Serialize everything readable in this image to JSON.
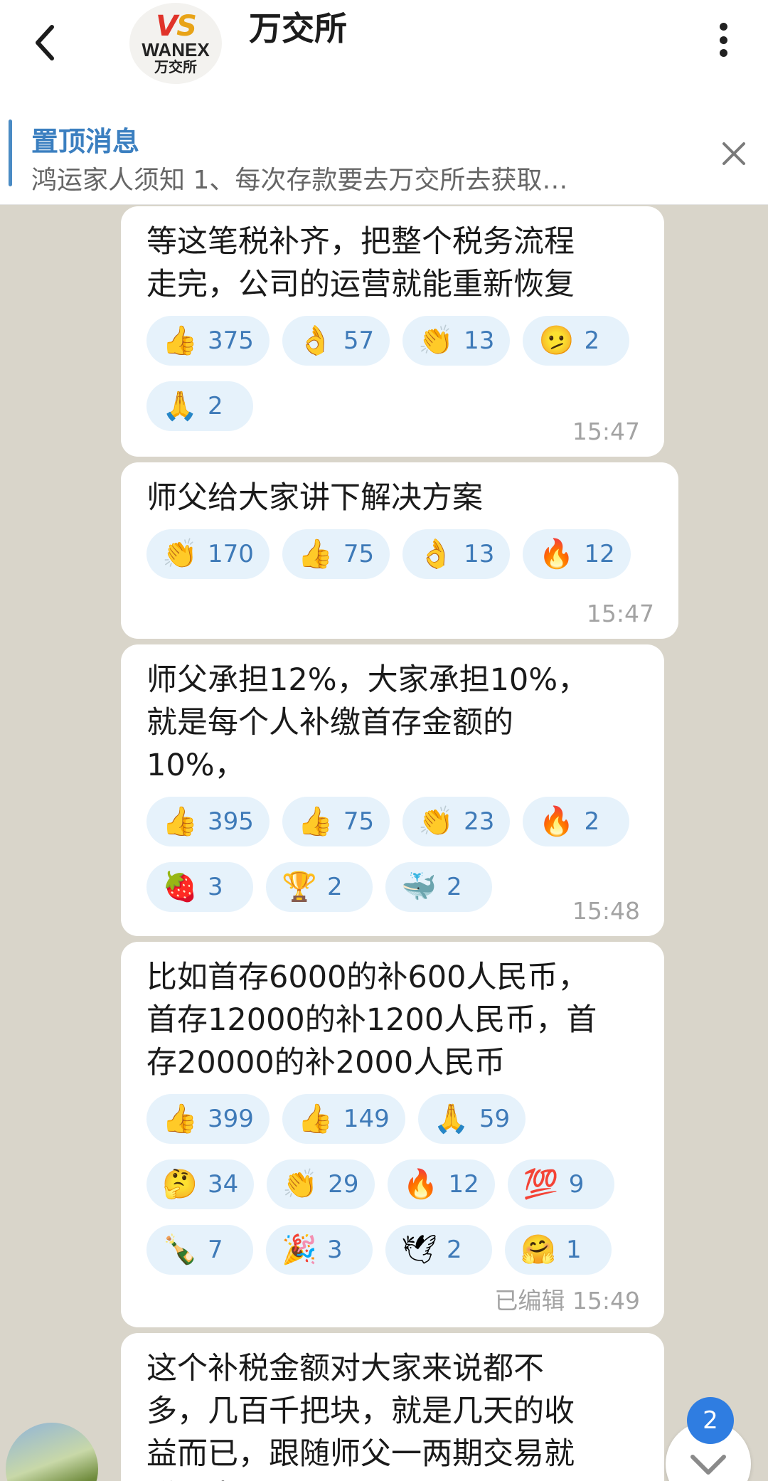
{
  "header": {
    "title": "万交所",
    "logo_mark": "VS",
    "logo_en": "WANEX",
    "logo_cn": "万交所"
  },
  "pinned": {
    "title": "置顶消息",
    "text": "鸿运家人须知  1、每次存款要去万交所去获取…"
  },
  "messages": [
    {
      "text": "等这笔税补齐，把整个税务流程\n走完，公司的运营就能重新恢复",
      "time": "15:47",
      "reactions": [
        {
          "emoji": "👍",
          "icon": "thumbs-up-icon",
          "count": "375"
        },
        {
          "emoji": "👌",
          "icon": "ok-hand-icon",
          "count": "57"
        },
        {
          "emoji": "👏",
          "icon": "clapping-hands-icon",
          "count": "13"
        },
        {
          "emoji": "🫤",
          "icon": "slightly-confused-face-icon",
          "count": "2"
        },
        {
          "emoji": "🙏",
          "icon": "folded-hands-icon",
          "count": "2"
        }
      ]
    },
    {
      "text": "师父给大家讲下解决方案",
      "time": "15:47",
      "reactions": [
        {
          "emoji": "👏",
          "icon": "clapping-hands-icon",
          "count": "170"
        },
        {
          "emoji": "👍",
          "icon": "thumbs-up-icon",
          "count": "75"
        },
        {
          "emoji": "👌",
          "icon": "ok-hand-icon",
          "count": "13"
        },
        {
          "emoji": "🔥",
          "icon": "fire-icon",
          "count": "12"
        }
      ]
    },
    {
      "text": "师父承担12%，大家承担10%，\n就是每个人补缴首存金额的\n10%，",
      "time": "15:48",
      "reactions": [
        {
          "emoji": "👍",
          "icon": "thumbs-up-icon",
          "count": "395"
        },
        {
          "emoji": "👍",
          "icon": "thumbs-up-icon",
          "count": "75"
        },
        {
          "emoji": "👏",
          "icon": "clapping-hands-icon",
          "count": "23"
        },
        {
          "emoji": "🔥",
          "icon": "fire-icon",
          "count": "2"
        },
        {
          "emoji": "🍓",
          "icon": "strawberry-icon",
          "count": "3"
        },
        {
          "emoji": "🏆",
          "icon": "trophy-icon",
          "count": "2"
        },
        {
          "emoji": "🐳",
          "icon": "whale-icon",
          "count": "2"
        }
      ]
    },
    {
      "text": "比如首存6000的补600人民币，\n首存12000的补1200人民币，首\n存20000的补2000人民币",
      "time": "已编辑 15:49",
      "reactions": [
        {
          "emoji": "👍",
          "icon": "thumbs-up-icon",
          "count": "399"
        },
        {
          "emoji": "👍",
          "icon": "thumbs-up-icon",
          "count": "149"
        },
        {
          "emoji": "🙏",
          "icon": "folded-hands-icon",
          "count": "59"
        },
        {
          "emoji": "🤔",
          "icon": "thinking-face-icon",
          "count": "34"
        },
        {
          "emoji": "👏",
          "icon": "clapping-hands-icon",
          "count": "29"
        },
        {
          "emoji": "🔥",
          "icon": "fire-icon",
          "count": "12"
        },
        {
          "emoji": "💯",
          "icon": "hundred-points-icon",
          "count": "9"
        },
        {
          "emoji": "🍾",
          "icon": "champagne-bottle-icon",
          "count": "7"
        },
        {
          "emoji": "🎉",
          "icon": "party-popper-icon",
          "count": "3"
        },
        {
          "emoji": "🕊",
          "icon": "dove-icon",
          "count": "2"
        },
        {
          "emoji": "🤗",
          "icon": "hugging-face-icon",
          "count": "1"
        }
      ]
    },
    {
      "text": "这个补税金额对大家来说都不\n多，几百千把块，就是几天的收\n益而已，跟随师父一两期交易就\n赚回来了",
      "time": "",
      "reactions": []
    }
  ],
  "unread_count": "2"
}
